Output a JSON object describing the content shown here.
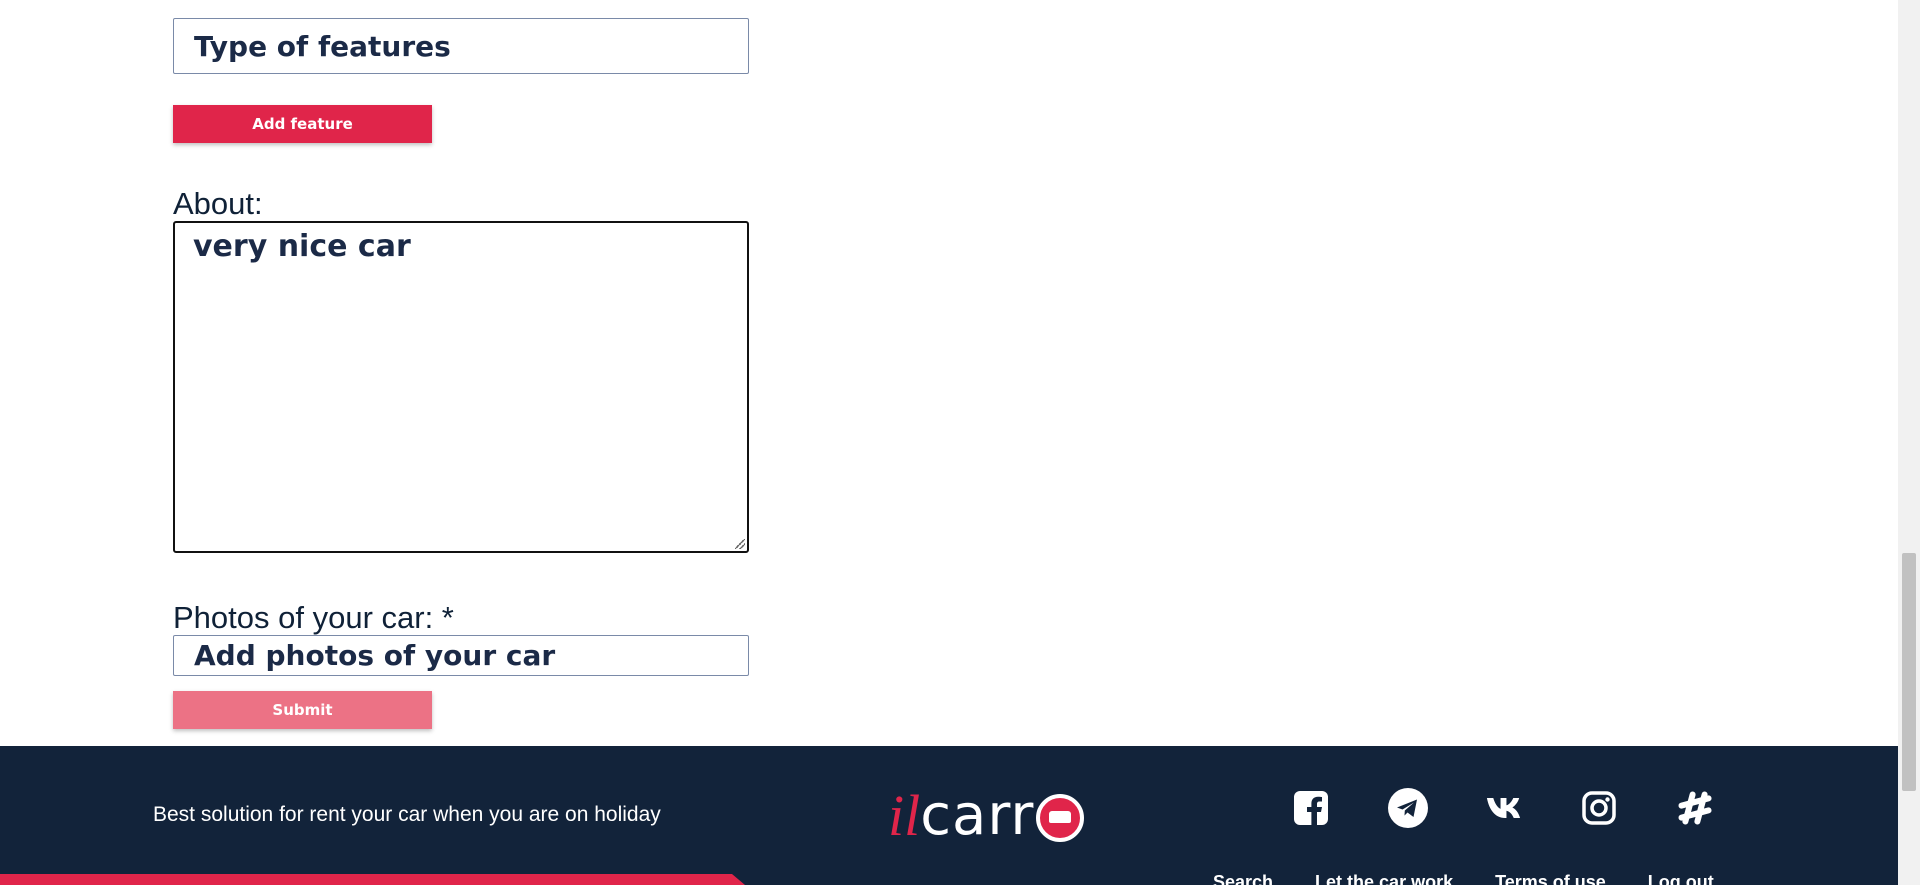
{
  "form": {
    "features_placeholder": "Type of features",
    "add_feature_label": "Add feature",
    "about_label": "About:",
    "about_value": "very nice car",
    "photos_label": "Photos of your car: *",
    "photos_placeholder": "Add photos of your car",
    "submit_label": "Submit"
  },
  "footer": {
    "tagline": "Best solution for rent your car when you are on holiday",
    "logo": {
      "il": "il",
      "carr": "carr"
    },
    "social": [
      {
        "icon": "facebook-icon"
      },
      {
        "icon": "telegram-icon"
      },
      {
        "icon": "vk-icon"
      },
      {
        "icon": "instagram-icon"
      },
      {
        "icon": "slack-icon"
      }
    ],
    "nav": [
      "Search",
      "Let the car work",
      "Terms of use",
      "Log out"
    ]
  },
  "colors": {
    "accent": "#e0254a",
    "accent_disabled": "#ec7285",
    "footer_bg": "#12233a",
    "text": "#0f2137"
  }
}
